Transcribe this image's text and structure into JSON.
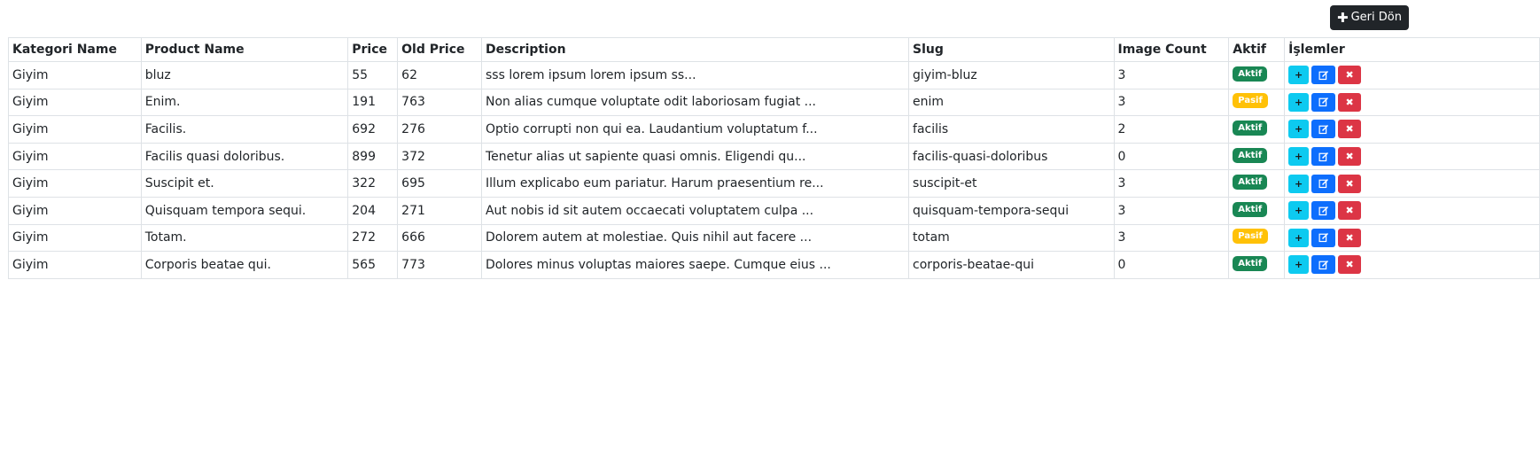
{
  "header": {
    "back_button_icon": "plus-icon",
    "back_button_label": "Geri Dön"
  },
  "table": {
    "columns": [
      "Kategori Name",
      "Product Name",
      "Price",
      "Old Price",
      "Description",
      "Slug",
      "Image Count",
      "Aktif",
      "İşlemler"
    ],
    "rows": [
      {
        "category": "Giyim",
        "product": "bluz",
        "price": "55",
        "old_price": "62",
        "description": "sss lorem ipsum lorem ipsum ss...",
        "slug": "giyim-bluz",
        "image_count": "3",
        "status": "Aktif"
      },
      {
        "category": "Giyim",
        "product": "Enim.",
        "price": "191",
        "old_price": "763",
        "description": "Non alias cumque voluptate odit laboriosam fugiat ...",
        "slug": "enim",
        "image_count": "3",
        "status": "Pasif"
      },
      {
        "category": "Giyim",
        "product": "Facilis.",
        "price": "692",
        "old_price": "276",
        "description": "Optio corrupti non qui ea. Laudantium voluptatum f...",
        "slug": "facilis",
        "image_count": "2",
        "status": "Aktif"
      },
      {
        "category": "Giyim",
        "product": "Facilis quasi doloribus.",
        "price": "899",
        "old_price": "372",
        "description": "Tenetur alias ut sapiente quasi omnis. Eligendi qu...",
        "slug": "facilis-quasi-doloribus",
        "image_count": "0",
        "status": "Aktif"
      },
      {
        "category": "Giyim",
        "product": "Suscipit et.",
        "price": "322",
        "old_price": "695",
        "description": "Illum explicabo eum pariatur. Harum praesentium re...",
        "slug": "suscipit-et",
        "image_count": "3",
        "status": "Aktif"
      },
      {
        "category": "Giyim",
        "product": "Quisquam tempora sequi.",
        "price": "204",
        "old_price": "271",
        "description": "Aut nobis id sit autem occaecati voluptatem culpa ...",
        "slug": "quisquam-tempora-sequi",
        "image_count": "3",
        "status": "Aktif"
      },
      {
        "category": "Giyim",
        "product": "Totam.",
        "price": "272",
        "old_price": "666",
        "description": "Dolorem autem at molestiae. Quis nihil aut facere ...",
        "slug": "totam",
        "image_count": "3",
        "status": "Pasif"
      },
      {
        "category": "Giyim",
        "product": "Corporis beatae qui.",
        "price": "565",
        "old_price": "773",
        "description": "Dolores minus voluptas maiores saepe. Cumque eius ...",
        "slug": "corporis-beatae-qui",
        "image_count": "0",
        "status": "Aktif"
      }
    ],
    "actions": {
      "add_symbol": "+",
      "edit_icon": "edit-icon",
      "delete_symbol": "✖"
    }
  },
  "colors": {
    "active_badge": "#198754",
    "passive_badge": "#ffc107",
    "add_button": "#0dcaf0",
    "edit_button": "#0d6efd",
    "delete_button": "#dc3545",
    "top_button": "#212529"
  }
}
